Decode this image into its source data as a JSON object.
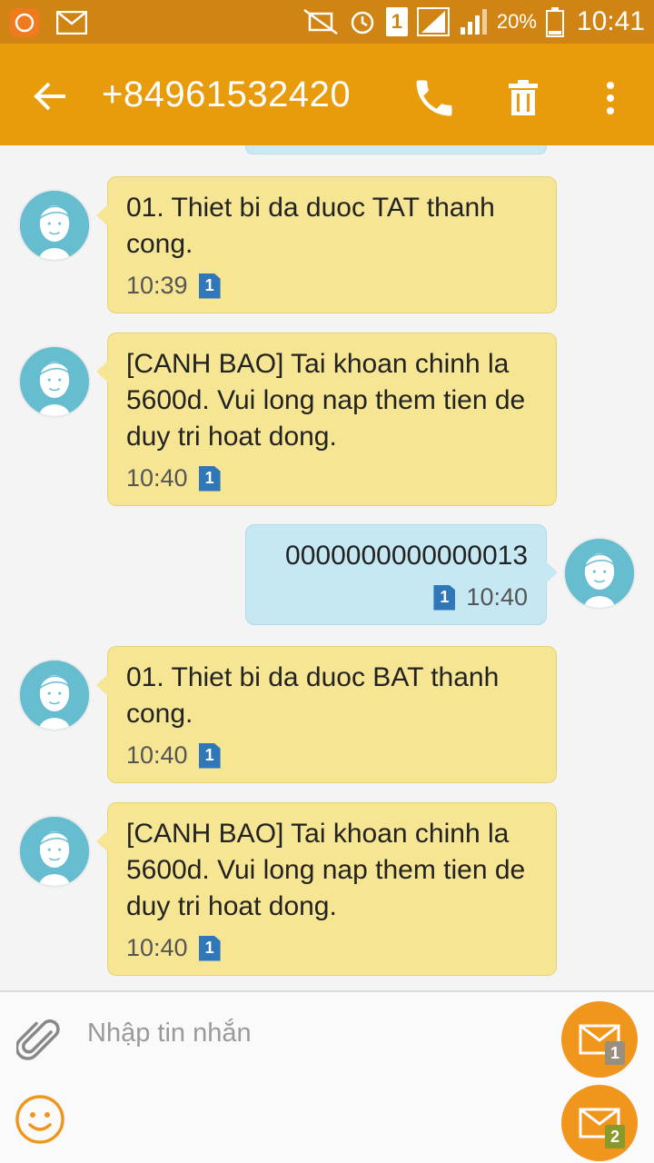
{
  "status_bar": {
    "battery_percent": "20%",
    "time": "10:41",
    "sim_slot": "1",
    "icons": [
      "app-notification-icon",
      "mail-icon",
      "mute-icon",
      "alarm-icon",
      "sim-icon",
      "signal-icon",
      "signal-icon",
      "battery-icon"
    ]
  },
  "app_bar": {
    "title": "+84961532420",
    "icons": [
      "back-arrow-icon",
      "phone-icon",
      "trash-icon",
      "more-vert-icon"
    ]
  },
  "messages": [
    {
      "direction": "in",
      "text": "01. Thiet bi da duoc TAT thanh cong.",
      "time": "10:39",
      "sim": "1"
    },
    {
      "direction": "in",
      "text": "[CANH BAO] Tai khoan chinh la 5600d. Vui long nap them tien de duy tri hoat dong.",
      "time": "10:40",
      "sim": "1"
    },
    {
      "direction": "out",
      "text": "0000000000000013",
      "time": "10:40",
      "sim": "1"
    },
    {
      "direction": "in",
      "text": "01. Thiet bi da duoc BAT thanh cong.",
      "time": "10:40",
      "sim": "1"
    },
    {
      "direction": "in",
      "text": "[CANH BAO] Tai khoan chinh la 5600d. Vui long nap them tien de duy tri hoat dong.",
      "time": "10:40",
      "sim": "1"
    }
  ],
  "composer": {
    "placeholder": "Nhập tin nhắn",
    "send_sim1_label": "1",
    "send_sim2_label": "2",
    "icons": [
      "paperclip-icon",
      "emoji-icon",
      "send-envelope-icon"
    ]
  },
  "colors": {
    "status_bar": "#cf8413",
    "app_bar": "#e89c0c",
    "incoming_bubble": "#f6e593",
    "outgoing_bubble": "#c6e8f2",
    "send_button": "#f0961d",
    "sim_badge": "#2f77b8"
  }
}
